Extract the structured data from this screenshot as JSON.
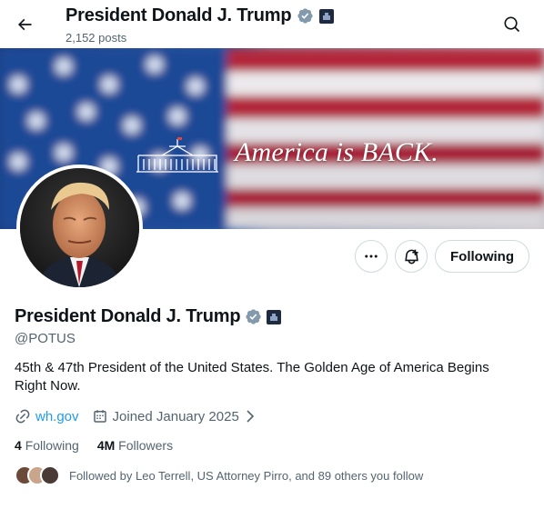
{
  "header": {
    "title": "President Donald J. Trump",
    "posts_count": "2,152 posts"
  },
  "banner": {
    "headline": "America is BACK."
  },
  "actions": {
    "follow_label": "Following"
  },
  "profile": {
    "name": "President Donald J. Trump",
    "handle": "@POTUS",
    "bio": "45th & 47th President of the United States. The Golden Age of America Begins Right Now.",
    "website": "wh.gov",
    "joined": "Joined January 2025",
    "following_count": "4",
    "following_label": "Following",
    "followers_count": "4M",
    "followers_label": "Followers",
    "followed_by": "Followed by Leo Terrell, US Attorney Pirro, and 89 others you follow"
  },
  "icons": [
    "back-arrow-icon",
    "search-icon",
    "verified-badge-icon",
    "government-badge-icon",
    "more-icon",
    "notification-bell-icon",
    "link-icon",
    "calendar-icon",
    "chevron-right-icon"
  ],
  "colors": {
    "accent": "#1d9bf0",
    "verified_gray": "#829aab",
    "text": "#0f1419",
    "muted": "#536471"
  }
}
